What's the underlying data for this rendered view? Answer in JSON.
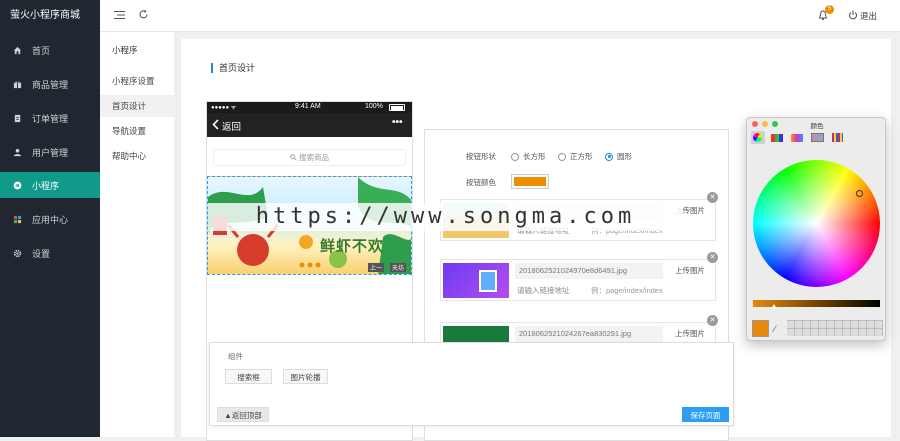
{
  "app": {
    "brand": "萤火小程序商城"
  },
  "sidebar": {
    "items": [
      {
        "label": "首页",
        "icon": "home-icon"
      },
      {
        "label": "商品管理",
        "icon": "gift-icon"
      },
      {
        "label": "订单管理",
        "icon": "clipboard-icon"
      },
      {
        "label": "用户管理",
        "icon": "user-icon"
      },
      {
        "label": "小程序",
        "icon": "miniprogram-icon"
      },
      {
        "label": "应用中心",
        "icon": "apps-icon"
      },
      {
        "label": "设置",
        "icon": "gear-icon"
      }
    ]
  },
  "topbar": {
    "notify_count": "5",
    "logout": "退出"
  },
  "subnav": {
    "title": "小程序",
    "items": [
      "小程序设置",
      "首页设计",
      "导航设置",
      "帮助中心"
    ]
  },
  "page": {
    "title": "首页设计"
  },
  "phone": {
    "status_left": "●●●●● ᯤ",
    "time": "9:41 AM",
    "battery": "100%",
    "back": "返回",
    "menu": "•••",
    "search": "搜索商品"
  },
  "banner": {
    "headline": "鲜虾不欢",
    "tag1": "上一",
    "tag2": "天坊"
  },
  "editor": {
    "shape_label": "按钮形状",
    "shapes": [
      "长方形",
      "正方形",
      "圆形"
    ],
    "shape_selected": "圆形",
    "color_label": "按钮颜色",
    "button_color": "#f08c00",
    "items": [
      {
        "file": "",
        "upload": "上传图片",
        "link_ph": "请输入链接地址",
        "link_val": "例：page/index/index"
      },
      {
        "file": "2018062521024970e8d6491.jpg",
        "upload": "上传图片",
        "link_ph": "请输入链接地址",
        "link_val": "例：page/index/index"
      },
      {
        "file": "2018062521024267ea830291.jpg",
        "upload": "上传图片",
        "link_ph": "",
        "link_val": ""
      }
    ]
  },
  "components": {
    "title": "组件",
    "buttons": [
      "搜索框",
      "图片轮播"
    ],
    "back_top": "返回顶部",
    "save": "保存页面"
  },
  "colorwin": {
    "title": "颜色",
    "swatch": "#e8890c"
  },
  "watermark": "https://www.songma.com"
}
